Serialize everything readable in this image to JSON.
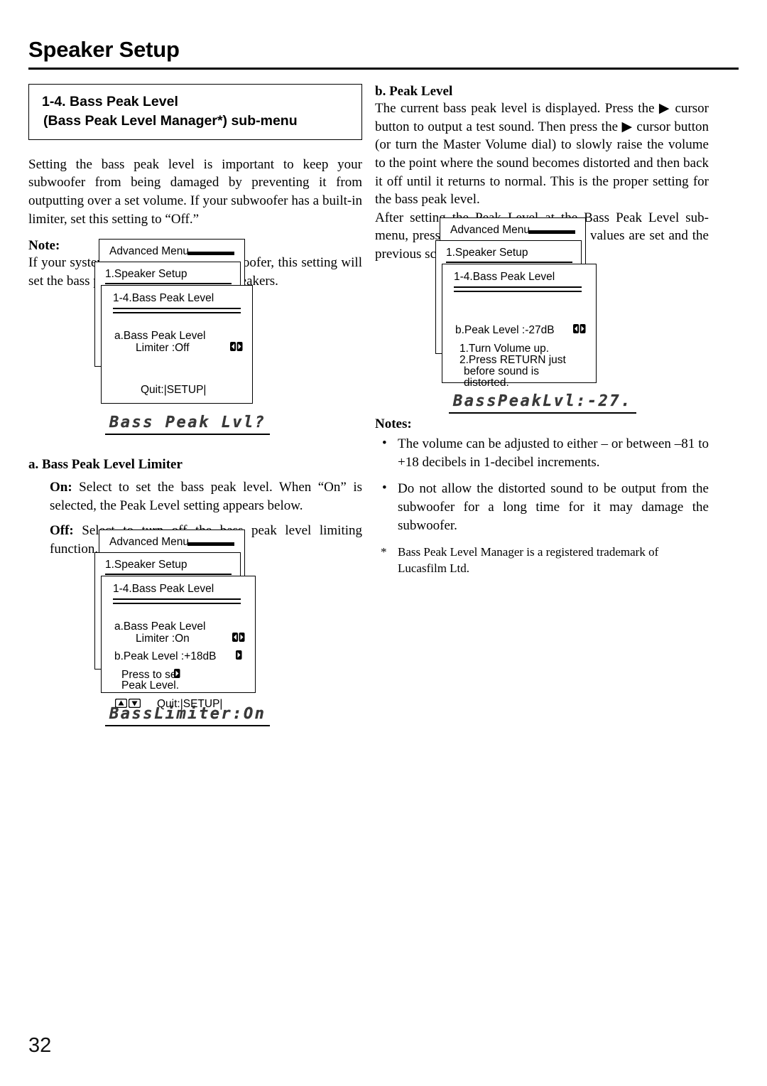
{
  "page": {
    "title": "Speaker Setup",
    "number": "32"
  },
  "left": {
    "heading_line1": "1-4.  Bass Peak Level",
    "heading_line2": "(Bass Peak Level Manager*) sub-menu",
    "intro": "Setting the bass peak level is important to keep your subwoofer from being damaged by preventing it from outputting over a set volume. If your subwoofer has a built-in limiter, set this setting to “Off.”",
    "note_label": "Note:",
    "note_body": "If your system does not include a subwoofer, this setting will set the bass peak level for your front speakers.",
    "lcd_1": "Bass Peak Lvl?",
    "section_a_title": "a. Bass Peak Level Limiter",
    "on_label": "On:",
    "on_text": " Select to set the bass peak level. When “On” is selected, the Peak Level setting appears below.",
    "off_label": "Off:",
    "off_text": " Select to turn off the bass peak level limiting function.",
    "lcd_2": "BassLimiter:On"
  },
  "right": {
    "section_b_title": "b. Peak Level",
    "para1": "The current bass peak level is displayed. Press the ▶ cursor button to output a test sound. Then press the ▶ cursor button (or turn the Master Volume dial) to slowly raise the volume to the point where the sound becomes distorted and then back it off until it returns to normal. This is the proper setting for the bass peak level.",
    "para2": "After setting the Peak Level at the Bass Peak Level sub-menu, press the RETURN button. The values are set and the previous screen appears.",
    "lcd_3": "BassPeakLvl:-27.",
    "notes_label": "Notes:",
    "notes": [
      "The volume can be adjusted to either –    or between –81 to +18 decibels in 1-decibel increments.",
      "Do not allow the distorted sound to be output from the subwoofer for a long time for it may damage the subwoofer."
    ],
    "footnote_marker": "*",
    "footnote": "Bass Peak Level Manager is a registered trademark of Lucasfilm Ltd."
  },
  "osd": {
    "menu_root": "Advanced Menu",
    "menu_level2": "1.Speaker Setup",
    "menu_level3": "1-4.Bass Peak Level",
    "screen1": {
      "item_a_l1": "a.Bass Peak Level",
      "item_a_l2": "Limiter :Off",
      "quit": "Quit:|SETUP|"
    },
    "screen2": {
      "item_a_l1": "a.Bass Peak Level",
      "item_a_l2": "Limiter :On",
      "item_b": "b.Peak Level   :+18dB",
      "hint_l1": "Press    to set",
      "hint_l2": "Peak Level.",
      "quit": "Quit:|SETUP|"
    },
    "screen3": {
      "item_b": "b.Peak Level   :-27dB",
      "step1": "1.Turn Volume up.",
      "step2": "2.Press RETURN just",
      "step3": "before sound is",
      "step4": "distorted."
    }
  }
}
